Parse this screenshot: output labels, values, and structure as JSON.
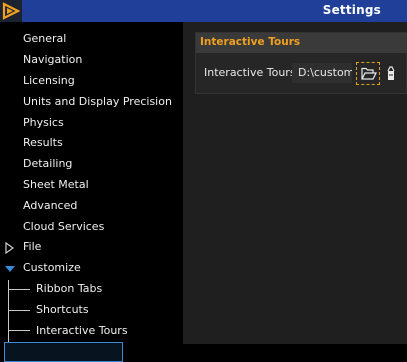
{
  "window": {
    "title": "Settings"
  },
  "sidebar": {
    "items": [
      {
        "label": "General"
      },
      {
        "label": "Navigation"
      },
      {
        "label": "Licensing"
      },
      {
        "label": "Units and Display Precision"
      },
      {
        "label": "Physics"
      },
      {
        "label": "Results"
      },
      {
        "label": "Detailing"
      },
      {
        "label": "Sheet Metal"
      },
      {
        "label": "Advanced"
      },
      {
        "label": "Cloud Services"
      },
      {
        "label": "File",
        "expanded": false
      },
      {
        "label": "Customize",
        "expanded": true
      }
    ],
    "customize_children": [
      {
        "label": "Ribbon Tabs"
      },
      {
        "label": "Shortcuts"
      },
      {
        "label": "Interactive Tours",
        "selected": true
      }
    ]
  },
  "panel": {
    "title": "Interactive Tours",
    "field_label": "Interactive Tours",
    "path_value": "D:\\custom",
    "browse_icon": "folder-open-icon",
    "clear_icon": "eraser-icon"
  },
  "colors": {
    "titlebar": "#1f3f99",
    "accent": "#f0a020",
    "selection": "#3a8ad6",
    "tree_arrow": "#3a8ad6"
  }
}
